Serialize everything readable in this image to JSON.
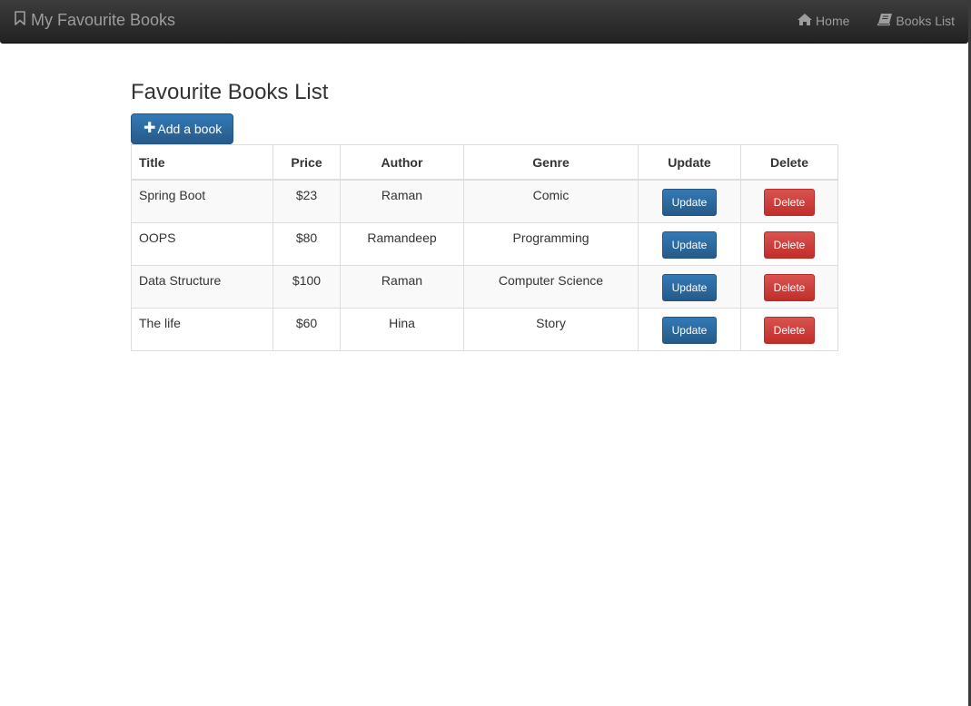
{
  "navbar": {
    "brand": "My Favourite Books",
    "brand_icon": "bookmark-icon",
    "links": [
      {
        "label": "Home",
        "icon": "home-icon"
      },
      {
        "label": "Books List",
        "icon": "book-icon"
      }
    ]
  },
  "main": {
    "title": "Favourite Books List",
    "add_button": "Add a book",
    "table": {
      "headers": [
        "Title",
        "Price",
        "Author",
        "Genre",
        "Update",
        "Delete"
      ],
      "rows": [
        {
          "title": "Spring Boot",
          "price": "$23",
          "author": "Raman",
          "genre": "Comic",
          "update": "Update",
          "delete": "Delete"
        },
        {
          "title": "OOPS",
          "price": "$80",
          "author": "Ramandeep",
          "genre": "Programming",
          "update": "Update",
          "delete": "Delete"
        },
        {
          "title": "Data Structure",
          "price": "$100",
          "author": "Raman",
          "genre": "Computer Science",
          "update": "Update",
          "delete": "Delete"
        },
        {
          "title": "The life",
          "price": "$60",
          "author": "Hina",
          "genre": "Story",
          "update": "Update",
          "delete": "Delete"
        }
      ]
    }
  },
  "colors": {
    "navbar": "#222222",
    "primary": "#337ab7",
    "danger": "#d9534f",
    "stripe": "#f9f9f9"
  }
}
